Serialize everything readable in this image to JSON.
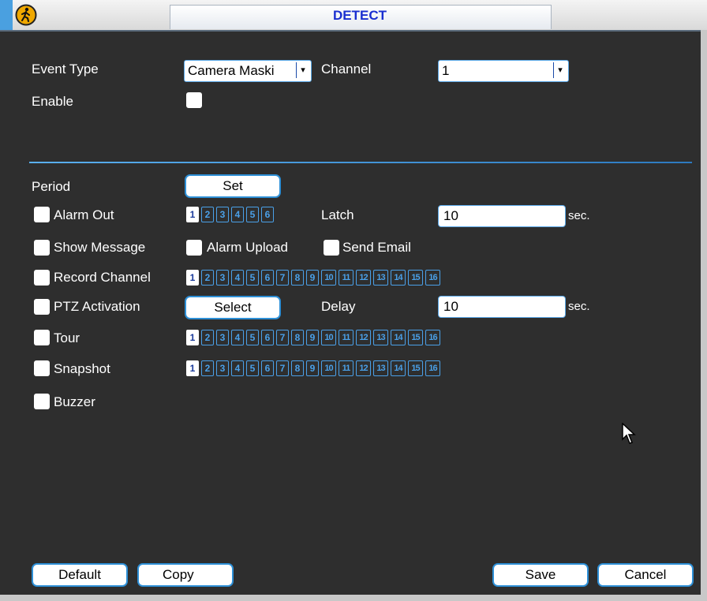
{
  "title": "DETECT",
  "event_type": {
    "label": "Event Type",
    "value": "Camera Maski"
  },
  "channel": {
    "label": "Channel",
    "value": "1"
  },
  "enable": {
    "label": "Enable"
  },
  "period": {
    "label": "Period",
    "button": "Set"
  },
  "alarm_out": {
    "label": "Alarm Out",
    "numbers": [
      "1",
      "2",
      "3",
      "4",
      "5",
      "6"
    ]
  },
  "latch": {
    "label": "Latch",
    "value": "10",
    "unit": "sec."
  },
  "show_message": {
    "label": "Show Message"
  },
  "alarm_upload": {
    "label": "Alarm Upload"
  },
  "send_email": {
    "label": "Send Email"
  },
  "record_channel": {
    "label": "Record Channel",
    "numbers": [
      "1",
      "2",
      "3",
      "4",
      "5",
      "6",
      "7",
      "8",
      "9",
      "10",
      "11",
      "12",
      "13",
      "14",
      "15",
      "16"
    ]
  },
  "ptz": {
    "label": "PTZ Activation",
    "button": "Select"
  },
  "delay": {
    "label": "Delay",
    "value": "10",
    "unit": "sec."
  },
  "tour": {
    "label": "Tour",
    "numbers": [
      "1",
      "2",
      "3",
      "4",
      "5",
      "6",
      "7",
      "8",
      "9",
      "10",
      "11",
      "12",
      "13",
      "14",
      "15",
      "16"
    ]
  },
  "snapshot": {
    "label": "Snapshot",
    "numbers": [
      "1",
      "2",
      "3",
      "4",
      "5",
      "6",
      "7",
      "8",
      "9",
      "10",
      "11",
      "12",
      "13",
      "14",
      "15",
      "16"
    ]
  },
  "buzzer": {
    "label": "Buzzer"
  },
  "buttons": {
    "default": "Default",
    "copy": "Copy",
    "save": "Save",
    "cancel": "Cancel"
  },
  "colors": {
    "background": "#2e2e2e",
    "accent": "#2d8fd6",
    "title_text": "#1a2fd0"
  },
  "icons": {
    "title": "pedestrian-alert-icon",
    "cursor": "mouse-pointer-icon"
  }
}
